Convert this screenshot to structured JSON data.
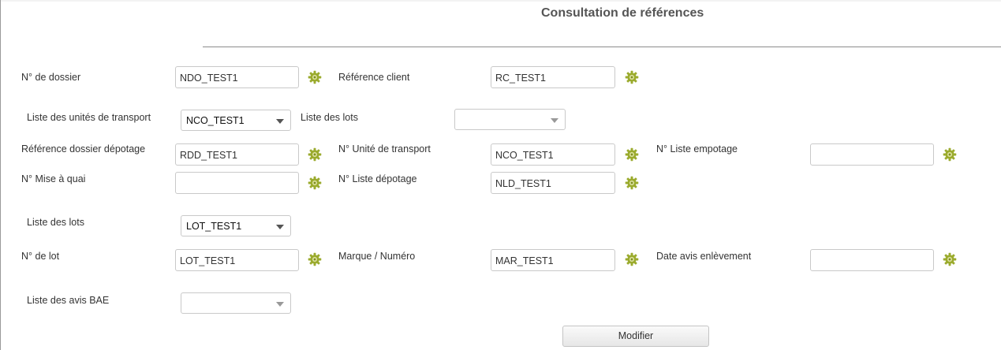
{
  "page": {
    "title": "Consultation de références"
  },
  "dossier": {
    "no_dossier": {
      "label": "N° de dossier",
      "value": "NDO_TEST1"
    },
    "reference_client": {
      "label": "Référence client",
      "value": "RC_TEST1"
    }
  },
  "transport": {
    "liste_unites": {
      "label": "Liste des unités de transport",
      "selected": "NCO_TEST1"
    },
    "liste_lots": {
      "label": "Liste des lots",
      "selected": ""
    },
    "ref_dossier_depotage": {
      "label": "Référence dossier dépotage",
      "value": "RDD_TEST1"
    },
    "no_unite_transport": {
      "label": "N° Unité de transport",
      "value": "NCO_TEST1"
    },
    "no_liste_empotage": {
      "label": "N° Liste empotage",
      "value": ""
    },
    "no_mise_a_quai": {
      "label": "N° Mise à quai",
      "value": ""
    },
    "no_liste_depotage": {
      "label": "N° Liste dépotage",
      "value": "NLD_TEST1"
    }
  },
  "lots": {
    "liste_lots": {
      "label": "Liste des lots",
      "selected": "LOT_TEST1"
    },
    "no_lot": {
      "label": "N° de lot",
      "value": "LOT_TEST1"
    },
    "marque_numero": {
      "label": "Marque / Numéro",
      "value": "MAR_TEST1"
    },
    "date_avis_enlevement": {
      "label": "Date avis enlèvement",
      "value": ""
    }
  },
  "bae": {
    "liste_avis": {
      "label": "Liste des avis BAE",
      "selected": ""
    }
  },
  "actions": {
    "modifier_label": "Modifier"
  },
  "icons": {
    "field_action": "gear-icon",
    "gear_color": "#9bab2e"
  }
}
